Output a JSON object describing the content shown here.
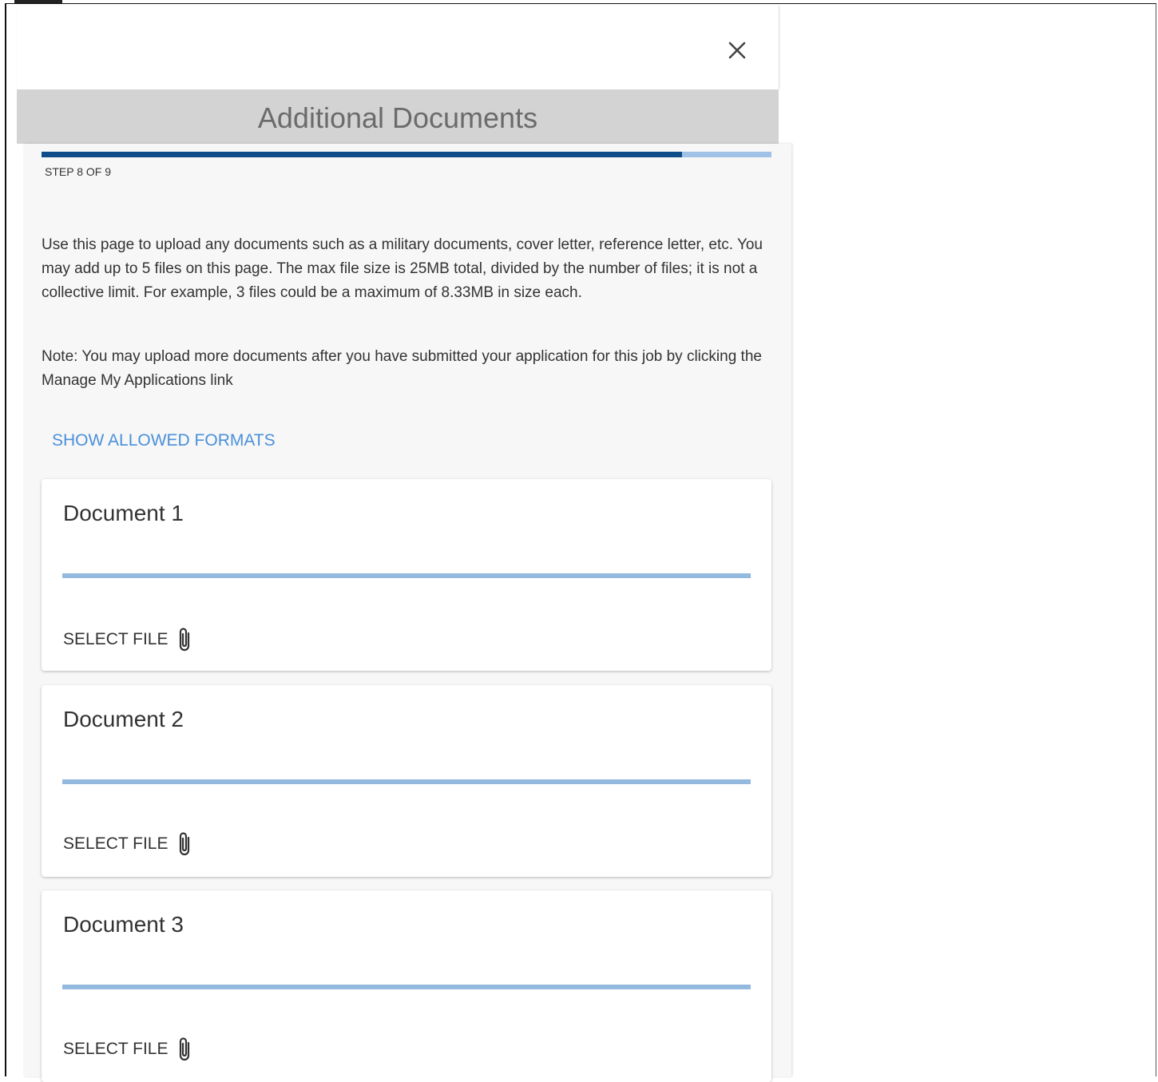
{
  "dialog": {
    "close_label": "×",
    "step_title": "Additional Documents"
  },
  "progress": {
    "fraction": 0.878,
    "step_text": "STEP 8 OF 9"
  },
  "instructions": {
    "intro": "Use this page to upload any documents such as a military documents, cover letter, reference letter, etc.  You may add up to 5 files on this page.  The max file size is 25MB total, divided by the number of files; it is not a collective limit.  For example, 3 files could be a maximum of 8.33MB in size each.",
    "note": "Note: You may upload more documents after you have submitted your application for this job by clicking the Manage My Applications link",
    "formats_link": "SHOW ALLOWED FORMATS"
  },
  "documents": [
    {
      "title": "Document 1",
      "select_label": "SELECT FILE",
      "icon": "paperclip-icon"
    },
    {
      "title": "Document 2",
      "select_label": "SELECT FILE",
      "icon": "paperclip-icon"
    },
    {
      "title": "Document 3",
      "select_label": "SELECT FILE",
      "icon": "paperclip-icon"
    }
  ],
  "colors": {
    "progress_fill": "#0f4c8a",
    "progress_track": "#9fc2e6",
    "link": "#4a90d9",
    "title_bar": "#d3d3d3"
  }
}
